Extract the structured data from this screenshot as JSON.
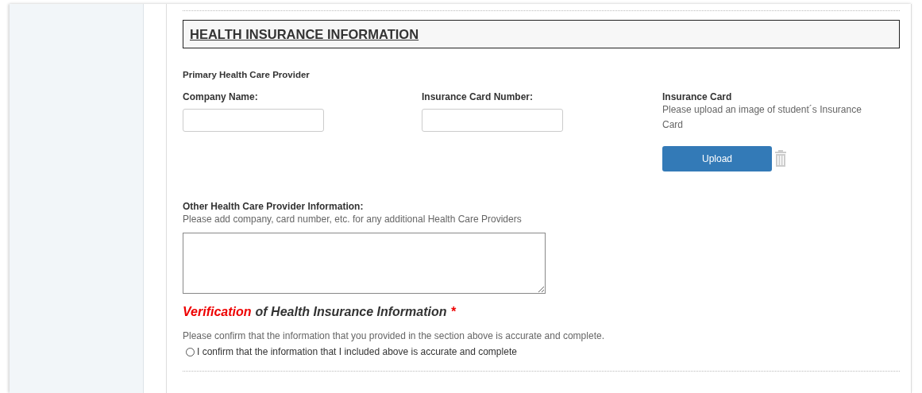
{
  "section_title": "HEALTH INSURANCE INFORMATION",
  "primary": {
    "heading": "Primary Health Care Provider",
    "fields": [
      {
        "label": "Company Name:"
      },
      {
        "label": "Insurance Card Number:"
      }
    ],
    "card": {
      "label": "Insurance Card",
      "hint": "Please upload an image of student´s Insurance Card",
      "button": "Upload"
    }
  },
  "other": {
    "label": "Other Health Care Provider Information:",
    "hint": "Please add company, card number, etc. for any additional Health Care Providers"
  },
  "verification": {
    "title_highlight": "Verification",
    "title": "of Health Insurance Information",
    "required_mark": "*",
    "hint": "Please confirm that the information that you provided in the section above is accurate and complete.",
    "options": [
      {
        "label": "I confirm that the information that I included above is accurate and complete",
        "selected": false
      }
    ]
  }
}
